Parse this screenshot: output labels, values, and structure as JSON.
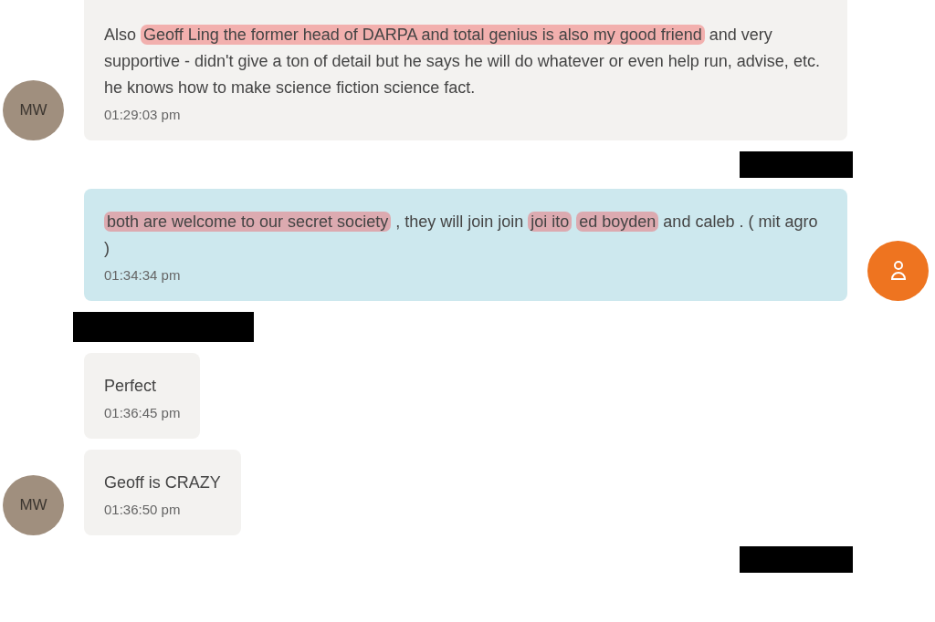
{
  "messages": [
    {
      "kind": "message",
      "outgoing": false,
      "avatar": {
        "kind": "initials",
        "initials": "MW"
      },
      "segments": [
        {
          "text": "Also ",
          "highlighted": false
        },
        {
          "text": "Geoff Ling the former head of DARPA and total genius is also my good friend",
          "highlighted": true
        },
        {
          "text": " and very supportive - didn't give a ton of detail but he says he will do whatever or even help run, advise, etc. he knows how to make science fiction science fact.",
          "highlighted": false
        }
      ],
      "time": "01:29:03 pm"
    },
    {
      "kind": "redaction",
      "on_left": false
    },
    {
      "kind": "message",
      "outgoing": true,
      "avatar": {
        "kind": "person"
      },
      "segments": [
        {
          "text": "both are welcome to our secret society",
          "highlighted": true
        },
        {
          "text": " , they will join join ",
          "highlighted": false
        },
        {
          "text": "joi ito",
          "highlighted": true
        },
        {
          "text": "ed boyden",
          "highlighted": true
        },
        {
          "text": " and caleb .  ( mit agro )",
          "highlighted": false
        }
      ],
      "time": "01:34:34 pm"
    },
    {
      "kind": "redaction",
      "on_left": true
    },
    {
      "kind": "message",
      "outgoing": false,
      "segments": [
        {
          "text": "Perfect",
          "highlighted": false
        }
      ],
      "time": "01:36:45 pm"
    },
    {
      "kind": "message",
      "outgoing": false,
      "avatar": {
        "kind": "initials",
        "initials": "MW"
      },
      "segments": [
        {
          "text": "Geoff is CRAZY",
          "highlighted": false
        }
      ],
      "time": "01:36:50 pm"
    },
    {
      "kind": "redaction",
      "on_left": false
    }
  ]
}
